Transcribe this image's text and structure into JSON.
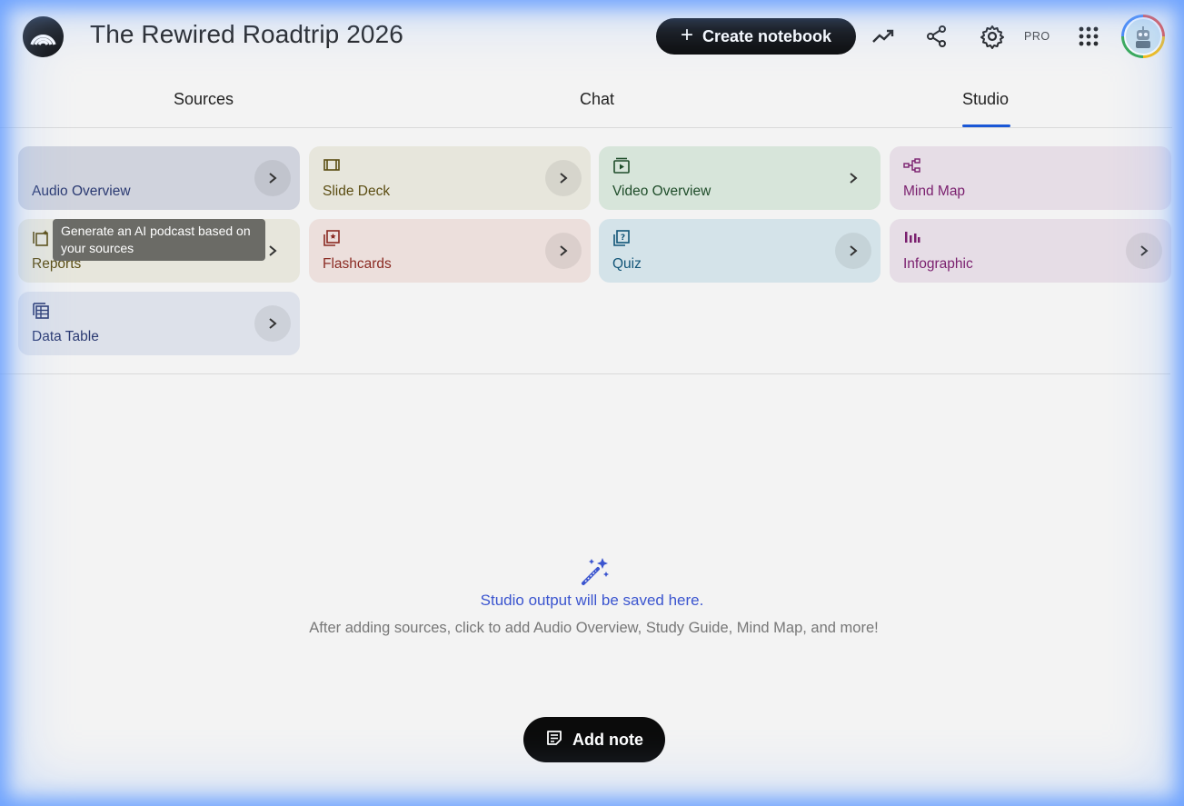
{
  "header": {
    "title": "The Rewired Roadtrip 2026",
    "create_label": "Create notebook",
    "create_icon": "plus",
    "pro_label": "PRO",
    "icons": [
      "analytics-icon",
      "share-icon",
      "settings-icon",
      "apps-grid-icon",
      "avatar"
    ]
  },
  "tabs": [
    {
      "label": "Sources",
      "active": false
    },
    {
      "label": "Chat",
      "active": false
    },
    {
      "label": "Studio",
      "active": true
    }
  ],
  "colors": {
    "accent": "#1a57d6",
    "empty_title": "#3b55cf"
  },
  "studio": {
    "cards": [
      {
        "label": "Audio Overview",
        "icon": "audio-waves-icon",
        "bg": "#d0d3dd",
        "fg": "#2b3a72"
      },
      {
        "label": "Slide Deck",
        "icon": "slides-icon",
        "bg": "#e7e6dc",
        "fg": "#5b4d12"
      },
      {
        "label": "Video Overview",
        "icon": "video-icon",
        "bg": "#d7e5da",
        "fg": "#1f4d2a"
      },
      {
        "label": "Mind Map",
        "icon": "mind-map-icon",
        "bg": "#e6dde6",
        "fg": "#7a1f6e"
      },
      {
        "label": "Reports",
        "icon": "reports-icon",
        "bg": "#e7e6dc",
        "fg": "#5b4d12"
      },
      {
        "label": "Flashcards",
        "icon": "flashcards-icon",
        "bg": "#ecdfdc",
        "fg": "#8a2a22"
      },
      {
        "label": "Quiz",
        "icon": "quiz-icon",
        "bg": "#d4e3e9",
        "fg": "#125578"
      },
      {
        "label": "Infographic",
        "icon": "infographic-icon",
        "bg": "#e6dde6",
        "fg": "#7a1f6e"
      },
      {
        "label": "Data Table",
        "icon": "table-icon",
        "bg": "#dde1ea",
        "fg": "#2b3a72"
      }
    ],
    "tooltip": "Generate an AI podcast based on your sources"
  },
  "empty_state": {
    "title": "Studio output will be saved here.",
    "subtitle": "After adding sources, click to add Audio Overview, Study Guide, Mind Map, and more!"
  },
  "add_note_label": "Add note"
}
